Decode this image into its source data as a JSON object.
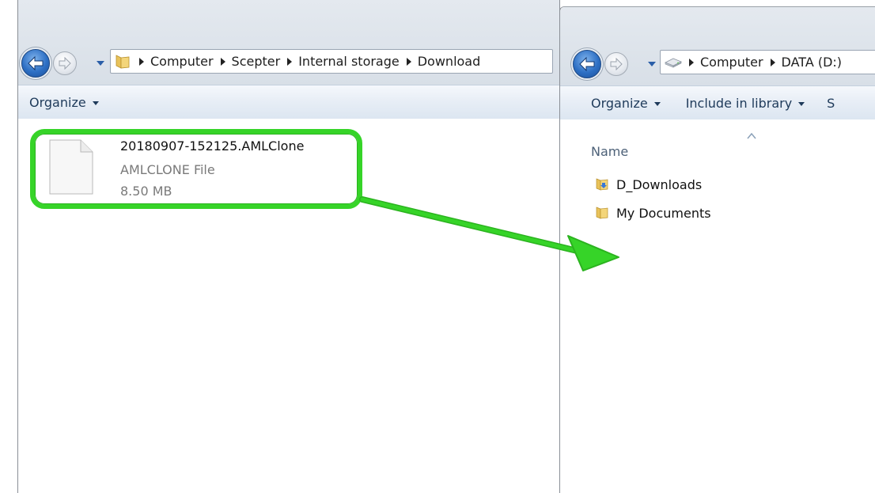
{
  "left_window": {
    "address_crumbs": [
      "Computer",
      "Scepter",
      "Internal storage",
      "Download"
    ],
    "command_bar": {
      "organize_label": "Organize"
    },
    "file": {
      "name": "20180907-152125.AMLClone",
      "type": "AMLCLONE File",
      "size": "8.50 MB",
      "icon": "document-icon"
    }
  },
  "right_window": {
    "address_crumbs": [
      "Computer",
      "DATA (D:)"
    ],
    "command_bar": {
      "organize_label": "Organize",
      "include_label": "Include in library",
      "overflow_label": "S"
    },
    "column_header": "Name",
    "items": [
      {
        "label": "D_Downloads",
        "icon": "downloads-folder-icon"
      },
      {
        "label": "My Documents",
        "icon": "folder-icon"
      }
    ]
  },
  "annotation": {
    "highlight_color": "#36d428",
    "arrow_color": "#36d428"
  }
}
